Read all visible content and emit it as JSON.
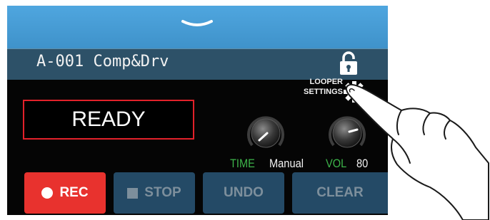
{
  "patch": {
    "name": "A-001 Comp&Drv"
  },
  "looper_settings": {
    "line1": "LOOPER",
    "line2": "SETTINGS"
  },
  "display": {
    "status": "READY"
  },
  "params": {
    "time": {
      "label": "TIME",
      "value": "Manual"
    },
    "vol": {
      "label": "VOL",
      "value": "80"
    }
  },
  "buttons": {
    "rec": "REC",
    "stop": "STOP",
    "undo": "UNDO",
    "clear": "CLEAR"
  },
  "colors": {
    "accent_red": "#e8322e",
    "param_green": "#3db54a",
    "top_blue": "#4fa6df",
    "button_blue": "#244a66"
  },
  "icons": [
    "chevron-down-icon",
    "lock-icon",
    "gear-icon",
    "record-icon",
    "stop-icon"
  ]
}
